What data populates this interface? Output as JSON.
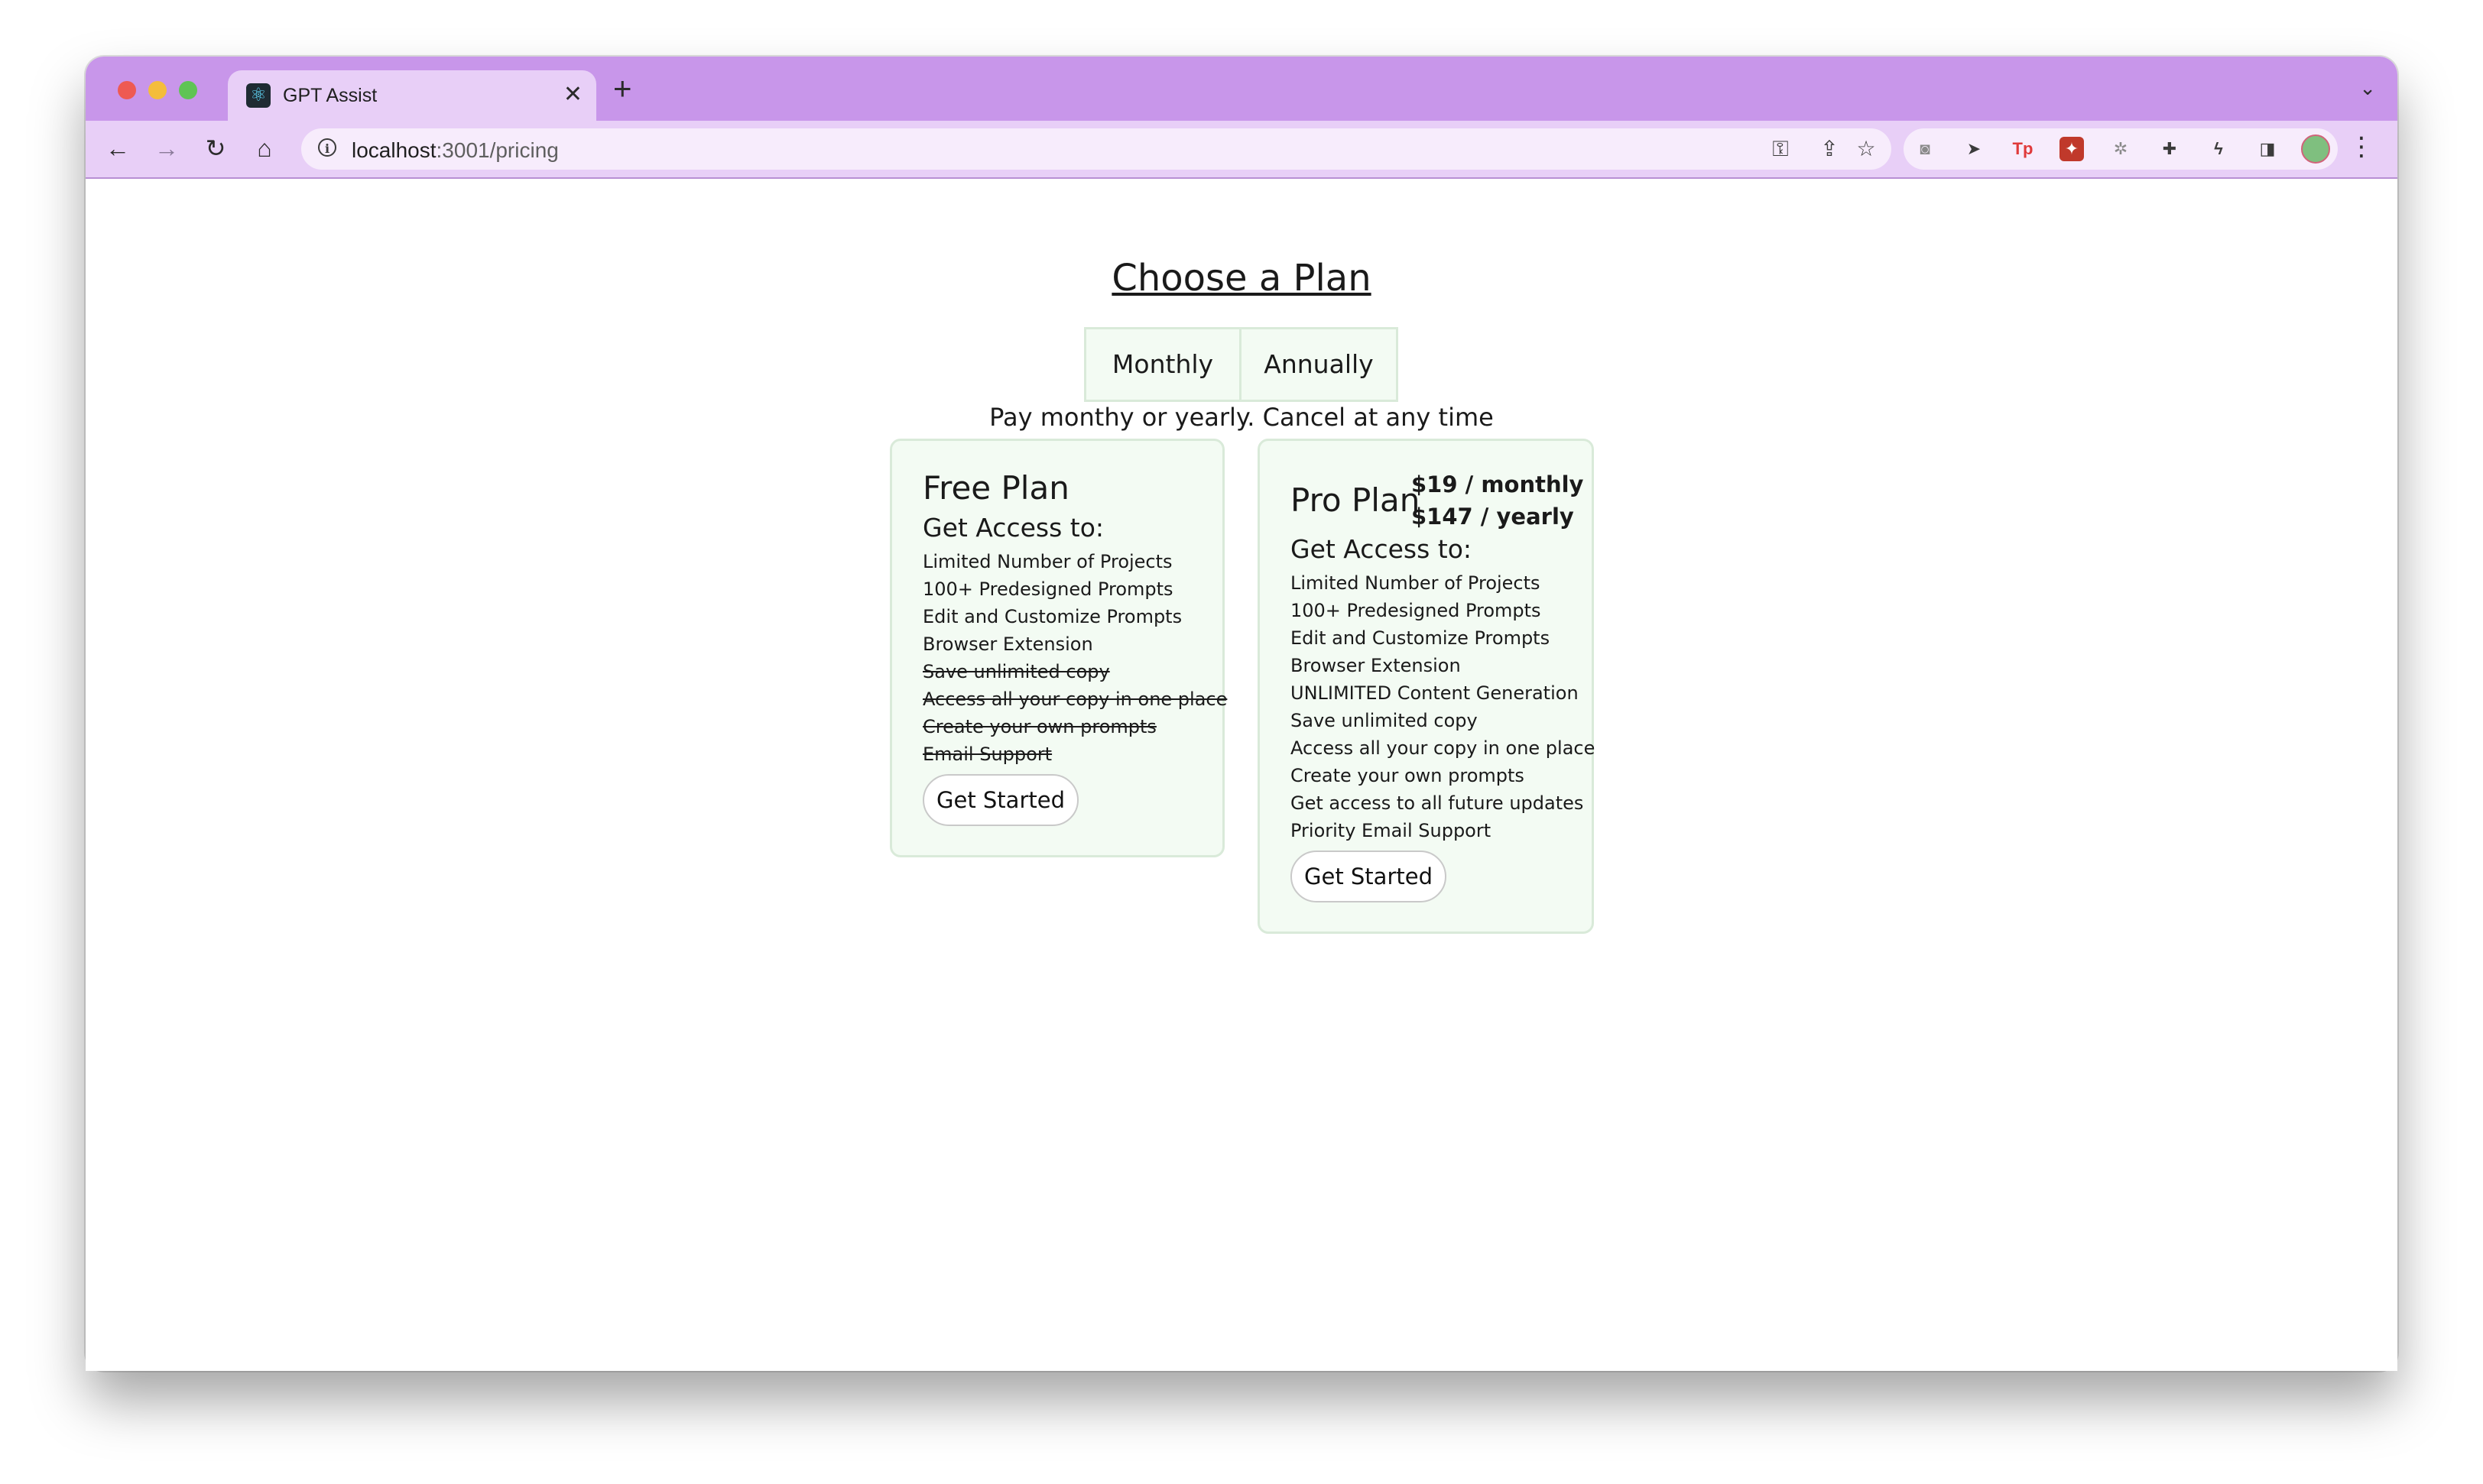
{
  "browser": {
    "tab_title": "GPT Assist",
    "tab_close": "✕",
    "new_tab": "+",
    "url_host": "localhost",
    "url_path": ":3001/pricing",
    "extensions": [
      "camera-icon",
      "cursor-icon",
      "tp-extension-icon",
      "game-extension-icon",
      "bug-icon",
      "puzzle-icon",
      "lightning-icon",
      "sidebar-icon"
    ],
    "tp_label": "Tp"
  },
  "page": {
    "title": "Choose a Plan",
    "toggle": {
      "monthly": "Monthly",
      "annually": "Annually"
    },
    "subtitle": "Pay monthy or yearly. Cancel at any time"
  },
  "plans": [
    {
      "name": "Free Plan",
      "access_label": "Get Access to:",
      "features": [
        {
          "text": "Limited Number of Projects",
          "included": true
        },
        {
          "text": "100+ Predesigned Prompts",
          "included": true
        },
        {
          "text": "Edit and Customize Prompts",
          "included": true
        },
        {
          "text": "Browser Extension",
          "included": true
        },
        {
          "text": "Save unlimited copy",
          "included": false
        },
        {
          "text": "Access all your copy in one place",
          "included": false
        },
        {
          "text": "Create your own prompts",
          "included": false
        },
        {
          "text": "Email Support",
          "included": false
        }
      ],
      "cta": "Get Started"
    },
    {
      "name": "Pro Plan",
      "price_monthly": "$19 / monthly",
      "price_yearly": "$147 / yearly",
      "access_label": "Get Access to:",
      "features": [
        {
          "text": "Limited Number of Projects",
          "included": true
        },
        {
          "text": "100+ Predesigned Prompts",
          "included": true
        },
        {
          "text": "Edit and Customize Prompts",
          "included": true
        },
        {
          "text": "Browser Extension",
          "included": true
        },
        {
          "text": "UNLIMITED Content Generation",
          "included": true
        },
        {
          "text": "Save unlimited copy",
          "included": true
        },
        {
          "text": "Access all your copy in one place",
          "included": true
        },
        {
          "text": "Create your own prompts",
          "included": true
        },
        {
          "text": "Get access to all future updates",
          "included": true
        },
        {
          "text": "Priority Email Support",
          "included": true
        }
      ],
      "cta": "Get Started"
    }
  ],
  "colors": {
    "titlebar": "#c896ea",
    "toolbar": "#e8cff7",
    "card_bg": "#f3fbf3",
    "card_border": "#d9ead9"
  }
}
